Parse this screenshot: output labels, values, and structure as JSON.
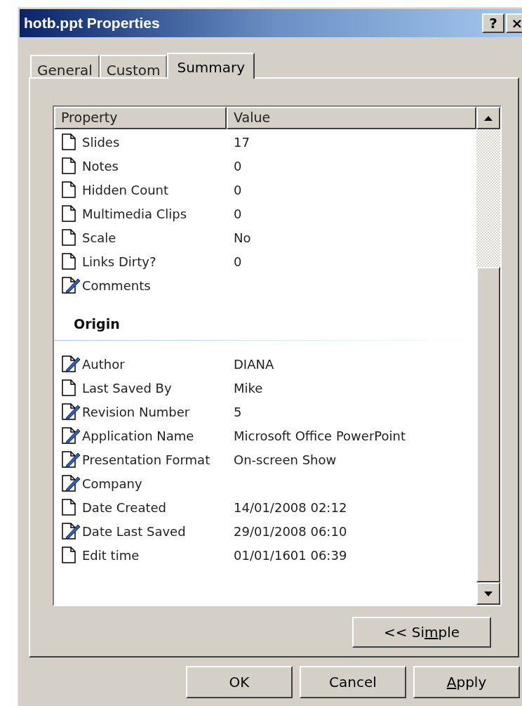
{
  "window": {
    "title": "hotb.ppt Properties",
    "buttons": [
      "?",
      "×"
    ]
  },
  "tabs": [
    {
      "label": "General",
      "selected": false
    },
    {
      "label": "Custom",
      "selected": false
    },
    {
      "label": "Summary",
      "selected": true
    }
  ],
  "table": {
    "columns": [
      "Property",
      "Value"
    ],
    "rows": [
      {
        "kind": "property",
        "name": "Slides",
        "value": "17",
        "editable": false
      },
      {
        "kind": "property",
        "name": "Notes",
        "value": "0",
        "editable": false
      },
      {
        "kind": "property",
        "name": "Hidden Count",
        "value": "0",
        "editable": false
      },
      {
        "kind": "property",
        "name": "Multimedia Clips",
        "value": "0",
        "editable": false
      },
      {
        "kind": "property",
        "name": "Scale",
        "value": "No",
        "editable": false
      },
      {
        "kind": "property",
        "name": "Links Dirty?",
        "value": "0",
        "editable": false
      },
      {
        "kind": "property",
        "name": "Comments",
        "editable": true
      },
      {
        "kind": "group",
        "name": "Origin"
      },
      {
        "kind": "property",
        "name": "Author",
        "value": "DIANA",
        "editable": true
      },
      {
        "kind": "property",
        "name": "Last Saved By",
        "value": "Mike",
        "editable": false
      },
      {
        "kind": "property",
        "name": "Revision Number",
        "value": "5",
        "editable": true
      },
      {
        "kind": "property",
        "name": "Application Name",
        "value": "Microsoft Office PowerPoint",
        "editable": true
      },
      {
        "kind": "property",
        "name": "Presentation Format",
        "value": "On-screen Show",
        "editable": true
      },
      {
        "kind": "property",
        "name": "Company",
        "editable": true
      },
      {
        "kind": "property",
        "name": "Date Created",
        "value": "14/01/2008 02:12",
        "editable": false
      },
      {
        "kind": "property",
        "name": "Date Last Saved",
        "value": "29/01/2008 06:10",
        "editable": true
      },
      {
        "kind": "property",
        "name": "Edit time",
        "value": "01/01/1601 06:39",
        "editable": false
      }
    ]
  },
  "toggle_button": {
    "label_parts": [
      {
        "text": "<< Si",
        "underline": false
      },
      {
        "text": "m",
        "underline": true
      },
      {
        "text": "ple",
        "underline": false
      }
    ]
  },
  "dialog_buttons": [
    {
      "label_parts": [
        {
          "text": "OK",
          "underline": false
        }
      ]
    },
    {
      "label_parts": [
        {
          "text": "Cancel",
          "underline": false
        }
      ]
    },
    {
      "label_parts": [
        {
          "text": "A",
          "underline": true
        },
        {
          "text": "pply",
          "underline": false
        }
      ]
    }
  ]
}
